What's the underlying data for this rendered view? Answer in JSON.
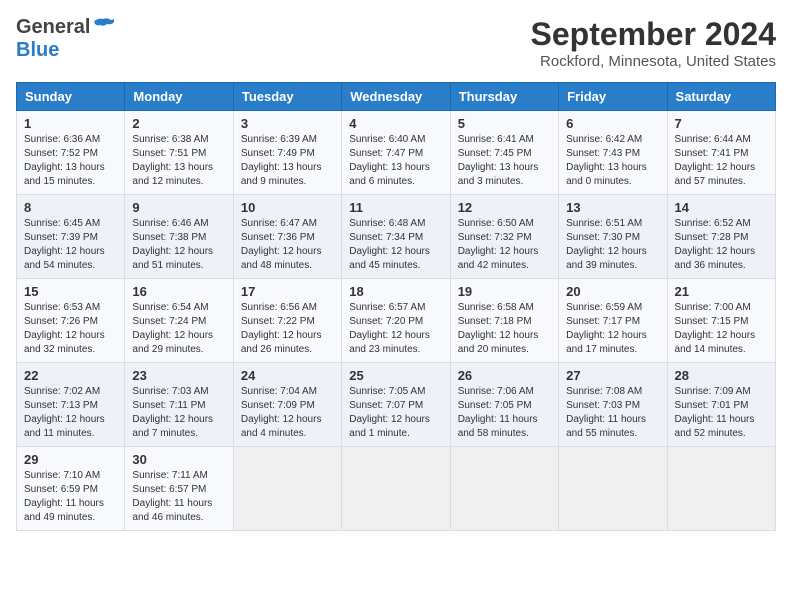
{
  "header": {
    "logo_general": "General",
    "logo_blue": "Blue",
    "month": "September 2024",
    "location": "Rockford, Minnesota, United States"
  },
  "weekdays": [
    "Sunday",
    "Monday",
    "Tuesday",
    "Wednesday",
    "Thursday",
    "Friday",
    "Saturday"
  ],
  "weeks": [
    [
      {
        "day": "1",
        "lines": [
          "Sunrise: 6:36 AM",
          "Sunset: 7:52 PM",
          "Daylight: 13 hours",
          "and 15 minutes."
        ]
      },
      {
        "day": "2",
        "lines": [
          "Sunrise: 6:38 AM",
          "Sunset: 7:51 PM",
          "Daylight: 13 hours",
          "and 12 minutes."
        ]
      },
      {
        "day": "3",
        "lines": [
          "Sunrise: 6:39 AM",
          "Sunset: 7:49 PM",
          "Daylight: 13 hours",
          "and 9 minutes."
        ]
      },
      {
        "day": "4",
        "lines": [
          "Sunrise: 6:40 AM",
          "Sunset: 7:47 PM",
          "Daylight: 13 hours",
          "and 6 minutes."
        ]
      },
      {
        "day": "5",
        "lines": [
          "Sunrise: 6:41 AM",
          "Sunset: 7:45 PM",
          "Daylight: 13 hours",
          "and 3 minutes."
        ]
      },
      {
        "day": "6",
        "lines": [
          "Sunrise: 6:42 AM",
          "Sunset: 7:43 PM",
          "Daylight: 13 hours",
          "and 0 minutes."
        ]
      },
      {
        "day": "7",
        "lines": [
          "Sunrise: 6:44 AM",
          "Sunset: 7:41 PM",
          "Daylight: 12 hours",
          "and 57 minutes."
        ]
      }
    ],
    [
      {
        "day": "8",
        "lines": [
          "Sunrise: 6:45 AM",
          "Sunset: 7:39 PM",
          "Daylight: 12 hours",
          "and 54 minutes."
        ]
      },
      {
        "day": "9",
        "lines": [
          "Sunrise: 6:46 AM",
          "Sunset: 7:38 PM",
          "Daylight: 12 hours",
          "and 51 minutes."
        ]
      },
      {
        "day": "10",
        "lines": [
          "Sunrise: 6:47 AM",
          "Sunset: 7:36 PM",
          "Daylight: 12 hours",
          "and 48 minutes."
        ]
      },
      {
        "day": "11",
        "lines": [
          "Sunrise: 6:48 AM",
          "Sunset: 7:34 PM",
          "Daylight: 12 hours",
          "and 45 minutes."
        ]
      },
      {
        "day": "12",
        "lines": [
          "Sunrise: 6:50 AM",
          "Sunset: 7:32 PM",
          "Daylight: 12 hours",
          "and 42 minutes."
        ]
      },
      {
        "day": "13",
        "lines": [
          "Sunrise: 6:51 AM",
          "Sunset: 7:30 PM",
          "Daylight: 12 hours",
          "and 39 minutes."
        ]
      },
      {
        "day": "14",
        "lines": [
          "Sunrise: 6:52 AM",
          "Sunset: 7:28 PM",
          "Daylight: 12 hours",
          "and 36 minutes."
        ]
      }
    ],
    [
      {
        "day": "15",
        "lines": [
          "Sunrise: 6:53 AM",
          "Sunset: 7:26 PM",
          "Daylight: 12 hours",
          "and 32 minutes."
        ]
      },
      {
        "day": "16",
        "lines": [
          "Sunrise: 6:54 AM",
          "Sunset: 7:24 PM",
          "Daylight: 12 hours",
          "and 29 minutes."
        ]
      },
      {
        "day": "17",
        "lines": [
          "Sunrise: 6:56 AM",
          "Sunset: 7:22 PM",
          "Daylight: 12 hours",
          "and 26 minutes."
        ]
      },
      {
        "day": "18",
        "lines": [
          "Sunrise: 6:57 AM",
          "Sunset: 7:20 PM",
          "Daylight: 12 hours",
          "and 23 minutes."
        ]
      },
      {
        "day": "19",
        "lines": [
          "Sunrise: 6:58 AM",
          "Sunset: 7:18 PM",
          "Daylight: 12 hours",
          "and 20 minutes."
        ]
      },
      {
        "day": "20",
        "lines": [
          "Sunrise: 6:59 AM",
          "Sunset: 7:17 PM",
          "Daylight: 12 hours",
          "and 17 minutes."
        ]
      },
      {
        "day": "21",
        "lines": [
          "Sunrise: 7:00 AM",
          "Sunset: 7:15 PM",
          "Daylight: 12 hours",
          "and 14 minutes."
        ]
      }
    ],
    [
      {
        "day": "22",
        "lines": [
          "Sunrise: 7:02 AM",
          "Sunset: 7:13 PM",
          "Daylight: 12 hours",
          "and 11 minutes."
        ]
      },
      {
        "day": "23",
        "lines": [
          "Sunrise: 7:03 AM",
          "Sunset: 7:11 PM",
          "Daylight: 12 hours",
          "and 7 minutes."
        ]
      },
      {
        "day": "24",
        "lines": [
          "Sunrise: 7:04 AM",
          "Sunset: 7:09 PM",
          "Daylight: 12 hours",
          "and 4 minutes."
        ]
      },
      {
        "day": "25",
        "lines": [
          "Sunrise: 7:05 AM",
          "Sunset: 7:07 PM",
          "Daylight: 12 hours",
          "and 1 minute."
        ]
      },
      {
        "day": "26",
        "lines": [
          "Sunrise: 7:06 AM",
          "Sunset: 7:05 PM",
          "Daylight: 11 hours",
          "and 58 minutes."
        ]
      },
      {
        "day": "27",
        "lines": [
          "Sunrise: 7:08 AM",
          "Sunset: 7:03 PM",
          "Daylight: 11 hours",
          "and 55 minutes."
        ]
      },
      {
        "day": "28",
        "lines": [
          "Sunrise: 7:09 AM",
          "Sunset: 7:01 PM",
          "Daylight: 11 hours",
          "and 52 minutes."
        ]
      }
    ],
    [
      {
        "day": "29",
        "lines": [
          "Sunrise: 7:10 AM",
          "Sunset: 6:59 PM",
          "Daylight: 11 hours",
          "and 49 minutes."
        ]
      },
      {
        "day": "30",
        "lines": [
          "Sunrise: 7:11 AM",
          "Sunset: 6:57 PM",
          "Daylight: 11 hours",
          "and 46 minutes."
        ]
      },
      {
        "day": "",
        "lines": []
      },
      {
        "day": "",
        "lines": []
      },
      {
        "day": "",
        "lines": []
      },
      {
        "day": "",
        "lines": []
      },
      {
        "day": "",
        "lines": []
      }
    ]
  ]
}
